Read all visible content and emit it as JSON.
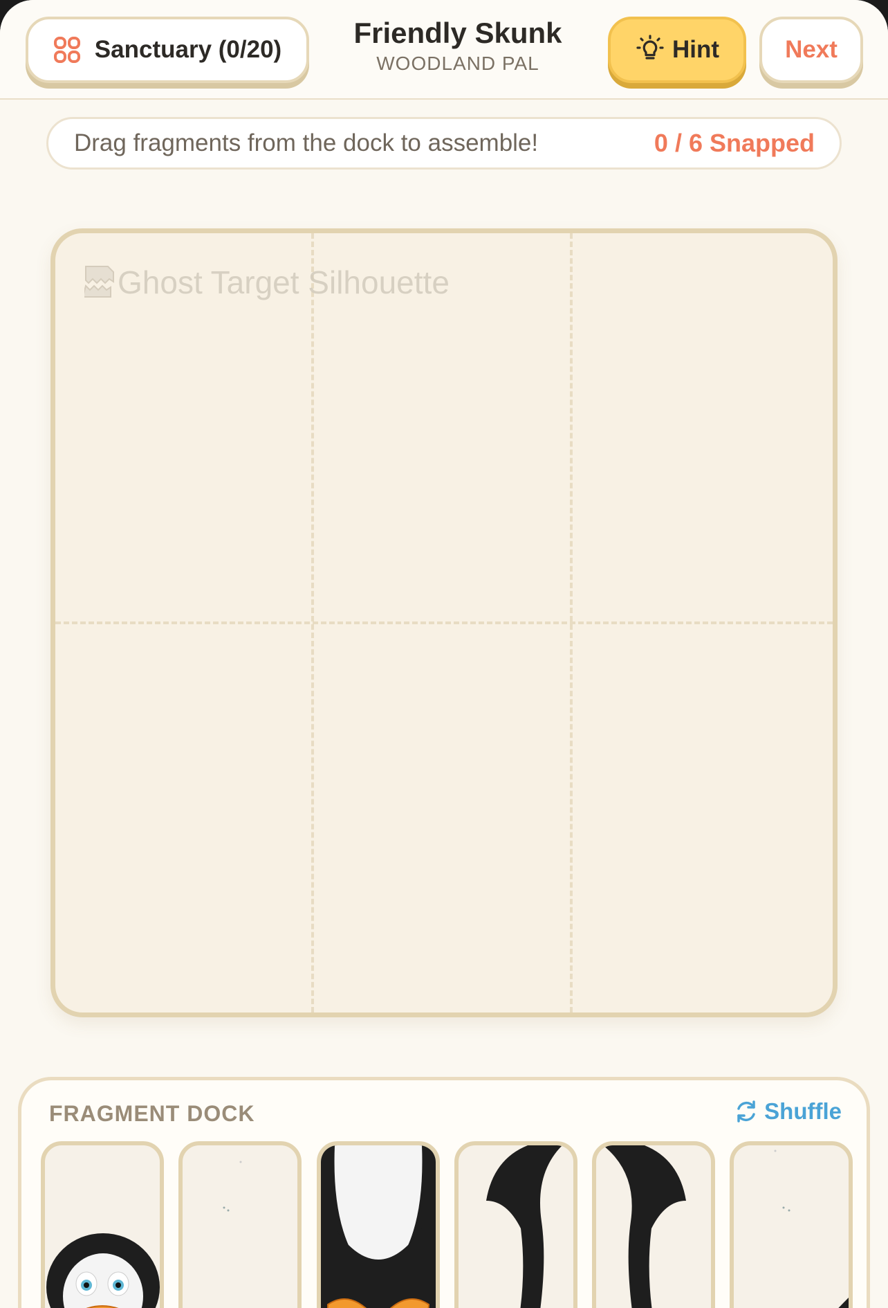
{
  "header": {
    "sanctuary_label": "Sanctuary (0/20)",
    "title": "Friendly Skunk",
    "subtitle": "WOODLAND PAL",
    "hint_label": "Hint",
    "next_label": "Next"
  },
  "status": {
    "message": "Drag fragments from the dock to assemble!",
    "snapped": "0 / 6 Snapped"
  },
  "board": {
    "ghost_alt": "Ghost Target Silhouette",
    "rows": 2,
    "cols": 3
  },
  "dock": {
    "title": "FRAGMENT DOCK",
    "shuffle_label": "Shuffle",
    "fragments": [
      {
        "name": "fragment-penguin-head",
        "icon": "penguin-head"
      },
      {
        "name": "fragment-penguin-side-left",
        "icon": "penguin-side"
      },
      {
        "name": "fragment-penguin-belly",
        "icon": "penguin-belly"
      },
      {
        "name": "fragment-penguin-flipper-left",
        "icon": "penguin-flipper"
      },
      {
        "name": "fragment-penguin-flipper-right",
        "icon": "penguin-flipper"
      },
      {
        "name": "fragment-penguin-side-right",
        "icon": "penguin-side"
      }
    ]
  },
  "colors": {
    "accent": "#f07a5a",
    "hint": "#ffd468",
    "shuffle": "#4aa3d6",
    "border": "#e2d3b0"
  }
}
